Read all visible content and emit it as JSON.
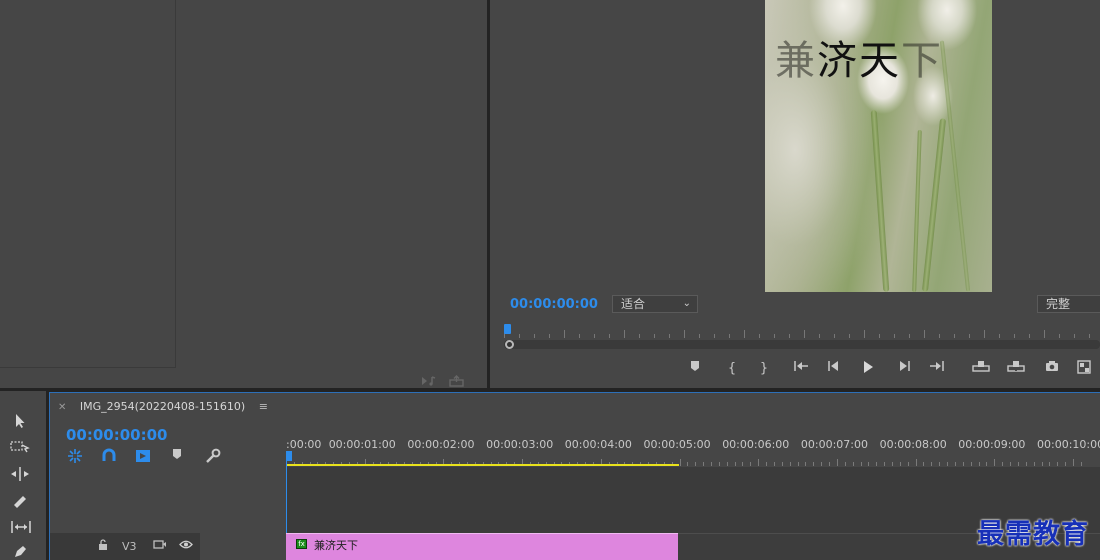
{
  "colors": {
    "accent_blue": "#2d8ceb",
    "clip_pink": "#de86de",
    "work_area_yellow": "#e9e21c",
    "panel_bg": "#464646"
  },
  "program_monitor": {
    "frame_title": "兼济天下",
    "timecode": "00:00:00:00",
    "fit_select": "适合",
    "quality_select": "完整",
    "transport_icons": [
      "marker-icon",
      "mark-in-icon",
      "mark-out-icon",
      "go-to-in-icon",
      "step-back-icon",
      "play-icon",
      "step-forward-icon",
      "go-to-out-icon",
      "lift-icon",
      "extract-icon",
      "export-frame-icon",
      "more-icon"
    ]
  },
  "tools": [
    "selection-tool-icon",
    "track-select-tool-icon",
    "ripple-edit-tool-icon",
    "razor-tool-icon",
    "slip-tool-icon",
    "pen-tool-icon"
  ],
  "timeline": {
    "sequence_name": "IMG_2954(20220408-151610)",
    "timecode": "00:00:00:00",
    "ruler_labels": [
      ":00:00",
      "00:00:01:00",
      "00:00:02:00",
      "00:00:03:00",
      "00:00:04:00",
      "00:00:05:00",
      "00:00:06:00",
      "00:00:07:00",
      "00:00:08:00",
      "00:00:09:00",
      "00:00:10:00"
    ],
    "track": {
      "label": "V3",
      "clip_name": "兼济天下"
    }
  },
  "watermark": "最需教育"
}
